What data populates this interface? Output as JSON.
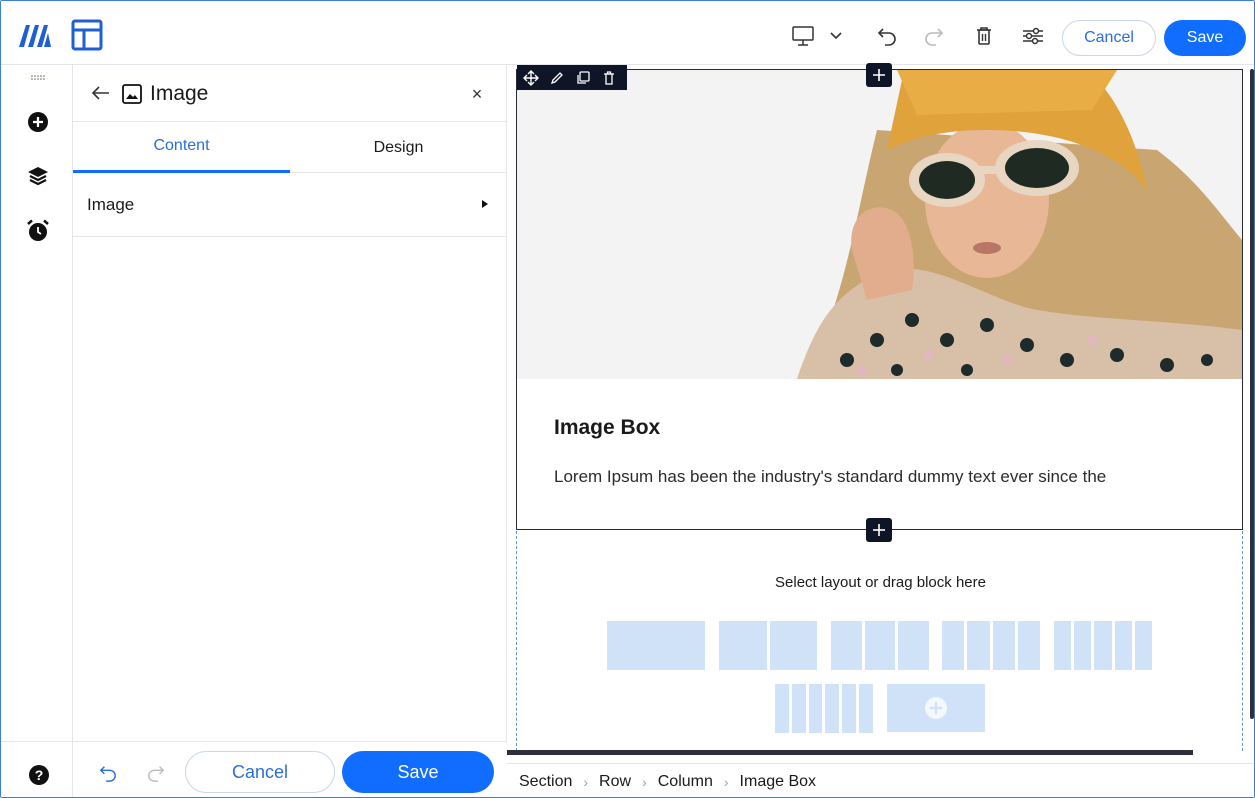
{
  "topbar": {
    "cancel_label": "Cancel",
    "save_label": "Save",
    "accent": "#116dff"
  },
  "panel": {
    "title": "Image",
    "tabs": [
      {
        "label": "Content",
        "active": true
      },
      {
        "label": "Design",
        "active": false
      }
    ],
    "sections": [
      {
        "label": "Image"
      }
    ],
    "footer": {
      "cancel_label": "Cancel",
      "save_label": "Save"
    }
  },
  "canvas": {
    "box_title": "Image Box",
    "box_text": "Lorem Ipsum has been the industry's standard dummy text ever since the",
    "dropzone_label": "Select layout or drag block here",
    "layout_options": [
      1,
      2,
      3,
      4,
      5,
      6
    ]
  },
  "breadcrumb": [
    "Section",
    "Row",
    "Column",
    "Image Box"
  ],
  "icons": {
    "logo": "brand-logo-icon",
    "layout": "layout-icon",
    "device": "desktop-icon",
    "undo": "undo-icon",
    "redo": "redo-icon",
    "delete": "trash-icon",
    "settings": "sliders-icon",
    "add": "plus-circle-icon",
    "layers": "layers-icon",
    "history": "alarm-clock-icon",
    "help": "help-circle-icon"
  }
}
